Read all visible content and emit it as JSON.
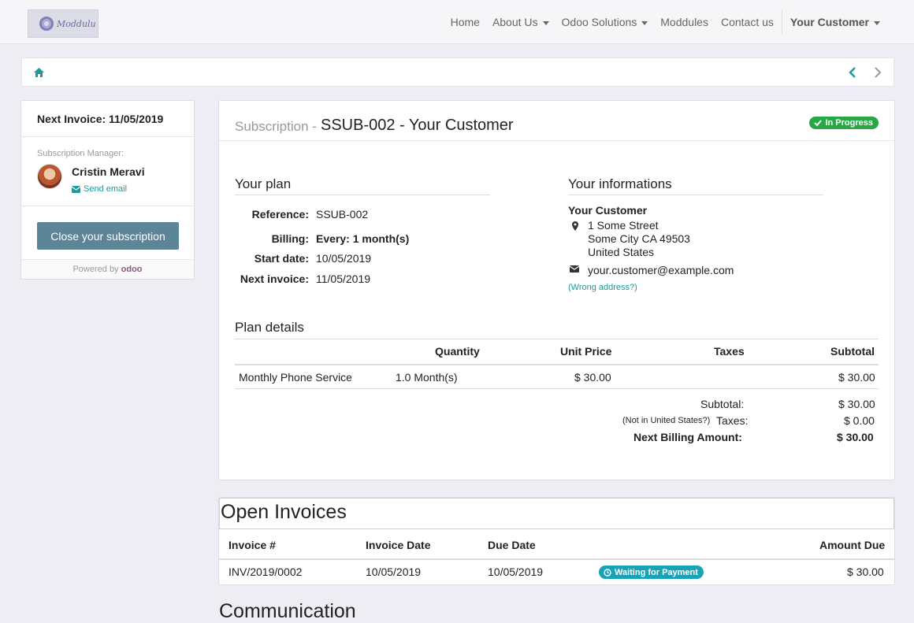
{
  "navbar": {
    "logo_text": "Moddulu",
    "items": [
      {
        "label": "Home",
        "dropdown": false
      },
      {
        "label": "About Us",
        "dropdown": true
      },
      {
        "label": "Odoo Solutions",
        "dropdown": true
      },
      {
        "label": "Moddules",
        "dropdown": false
      },
      {
        "label": "Contact us",
        "dropdown": false
      }
    ],
    "user": "Your Customer"
  },
  "breadcrumb": {
    "home_icon": "home-icon",
    "prev_icon": "chevron-left-icon",
    "next_icon": "chevron-right-icon"
  },
  "sidebar": {
    "next_invoice": "Next Invoice: 11/05/2019",
    "manager_label": "Subscription Manager:",
    "manager_name": "Cristin Meravi",
    "send_email": "Send email",
    "close_button": "Close your subscription",
    "powered_by": "Powered by",
    "odoo": "odoo"
  },
  "subscription": {
    "prefix": "Subscription -",
    "title": "SSUB-002 - Your Customer",
    "status": "In Progress",
    "plan_heading": "Your plan",
    "reference_label": "Reference:",
    "reference_value": "SSUB-002",
    "billing_label": "Billing:",
    "billing_value": "Every: 1 month(s)",
    "start_label": "Start date:",
    "start_value": "10/05/2019",
    "next_label": "Next invoice:",
    "next_value": "11/05/2019",
    "info_heading": "Your informations",
    "customer_name": "Your Customer",
    "address_line1": "1 Some Street",
    "address_line2": "Some City CA 49503",
    "address_line3": "United States",
    "email": "your.customer@example.com",
    "wrong_address": "(Wrong address?)",
    "details_heading": "Plan details",
    "columns": {
      "quantity": "Quantity",
      "unit_price": "Unit Price",
      "taxes": "Taxes",
      "subtotal": "Subtotal"
    },
    "lines": [
      {
        "product": "Monthly Phone Service",
        "quantity": "1.0 Month(s)",
        "unit_price": "$ 30.00",
        "taxes": "",
        "subtotal": "$ 30.00"
      }
    ],
    "totals": {
      "subtotal_label": "Subtotal:",
      "subtotal_value": "$ 30.00",
      "not_in_us": "(Not in United States?)",
      "taxes_label": "Taxes:",
      "taxes_value": "$ 0.00",
      "next_billing_label": "Next Billing Amount:",
      "next_billing_value": "$ 30.00"
    }
  },
  "invoices": {
    "heading": "Open Invoices",
    "columns": {
      "number": "Invoice #",
      "date": "Invoice Date",
      "due": "Due Date",
      "amount": "Amount Due"
    },
    "rows": [
      {
        "number": "INV/2019/0002",
        "date": "10/05/2019",
        "due": "10/05/2019",
        "status": "Waiting for Payment",
        "amount": "$ 30.00"
      }
    ]
  },
  "communication_heading": "Communication",
  "colors": {
    "accent": "#1a9a9a",
    "success": "#28a745",
    "info": "#17a2b8",
    "button": "#5c8597"
  }
}
